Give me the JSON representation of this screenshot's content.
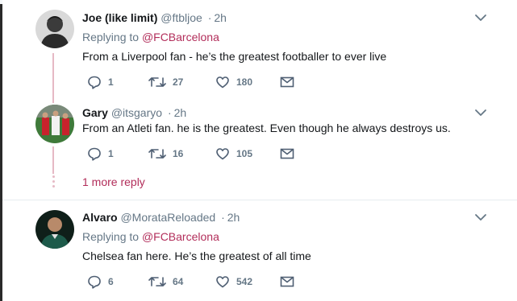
{
  "tweets": [
    {
      "name": "Joe (like limit)",
      "handle": "@ftbljoe",
      "time": "2h",
      "replying_prefix": "Replying to ",
      "replying_to": "@FCBarcelona",
      "text": "From a Liverpool fan - he’s the greatest footballer to ever live",
      "replies": "1",
      "retweets": "27",
      "likes": "180"
    },
    {
      "name": "Gary",
      "handle": "@itsgaryo",
      "time": "2h",
      "text": "From an Atleti fan. he is the greatest. Even though he always destroys us.",
      "replies": "1",
      "retweets": "16",
      "likes": "105",
      "more_replies": "1 more reply"
    },
    {
      "name": "Alvaro",
      "handle": "@MorataReloaded",
      "time": "2h",
      "replying_prefix": "Replying to ",
      "replying_to": "@FCBarcelona",
      "text": "Chelsea fan here. He’s the greatest of all time",
      "replies": "6",
      "retweets": "64",
      "likes": "542"
    }
  ],
  "separator": "·",
  "icons": {
    "reply": "reply-icon",
    "retweet": "retweet-icon",
    "like": "heart-icon",
    "dm": "envelope-icon",
    "menu": "chevron-down-icon"
  },
  "colors": {
    "link": "#b22d5a",
    "thread_line": "#e6b9c5",
    "muted": "#657786",
    "text": "#14171a"
  }
}
